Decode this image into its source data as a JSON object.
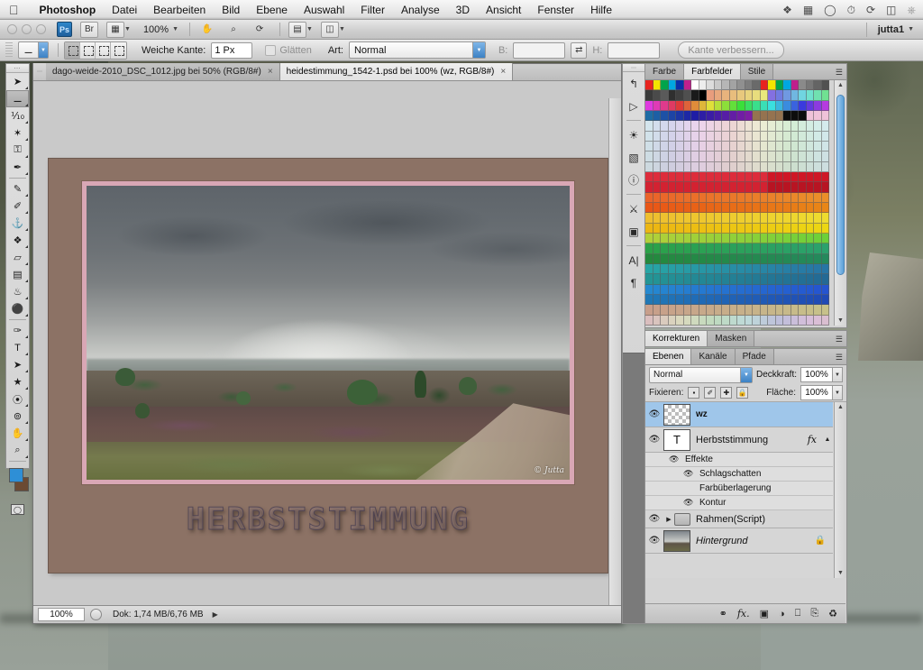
{
  "menubar": {
    "apple_icon": "apple-icon",
    "app_name": "Photoshop",
    "items": [
      "Datei",
      "Bearbeiten",
      "Bild",
      "Ebene",
      "Auswahl",
      "Filter",
      "Analyse",
      "3D",
      "Ansicht",
      "Fenster",
      "Hilfe"
    ],
    "status_icons": [
      "dropbox-icon",
      "display-icon",
      "chat-icon",
      "timemachine-icon",
      "sync-icon",
      "screen-icon",
      "bluetooth-icon"
    ]
  },
  "appbar": {
    "ps_badge": "Ps",
    "bridge_label": "Br",
    "viewextras_icon": "view-extras-icon",
    "zoom_level": "100%",
    "hand_icon": "hand-tool-icon",
    "zoom_icon": "zoom-tool-icon",
    "rotate_icon": "rotate-view-icon",
    "arrange_icon": "arrange-documents-icon",
    "screenmode_icon": "screen-mode-icon",
    "workspace": "jutta1"
  },
  "options": {
    "tool_preset_icon": "rectangular-marquee-icon",
    "selection_modes": [
      "new-selection",
      "add-to-selection",
      "subtract-from-selection",
      "intersect-selection"
    ],
    "feather_label": "Weiche Kante:",
    "feather_value": "1 Px",
    "antialias_label": "Glätten",
    "style_label": "Art:",
    "style_value": "Normal",
    "width_label": "B:",
    "width_value": "",
    "swap_icon": "swap-dimensions-icon",
    "height_label": "H:",
    "height_value": "",
    "refine_edge_label": "Kante verbessern..."
  },
  "toolbox": {
    "tools_top": [
      {
        "name": "move-tool",
        "glyph": "➤"
      },
      {
        "name": "rectangular-marquee-tool",
        "glyph": "⬚",
        "selected": true
      },
      {
        "name": "lasso-tool",
        "glyph": "⊃"
      },
      {
        "name": "magic-wand-tool",
        "glyph": "✦"
      },
      {
        "name": "crop-tool",
        "glyph": "⌗"
      },
      {
        "name": "eyedropper-tool",
        "glyph": "✒"
      }
    ],
    "tools_mid": [
      {
        "name": "healing-brush-tool",
        "glyph": "✐"
      },
      {
        "name": "brush-tool",
        "glyph": "✎"
      },
      {
        "name": "clone-stamp-tool",
        "glyph": "⚑"
      },
      {
        "name": "history-brush-tool",
        "glyph": "❦"
      },
      {
        "name": "eraser-tool",
        "glyph": "▱"
      },
      {
        "name": "gradient-tool",
        "glyph": "▨"
      },
      {
        "name": "blur-tool",
        "glyph": "●"
      },
      {
        "name": "dodge-tool",
        "glyph": "⚲"
      }
    ],
    "tools_bottom": [
      {
        "name": "pen-tool",
        "glyph": "✑"
      },
      {
        "name": "type-tool",
        "glyph": "T"
      },
      {
        "name": "path-selection-tool",
        "glyph": "➤"
      },
      {
        "name": "shape-tool",
        "glyph": "▰"
      },
      {
        "name": "3d-rotate-tool",
        "glyph": "⦿"
      },
      {
        "name": "3d-orbit-tool",
        "glyph": "⊚"
      },
      {
        "name": "hand-tool",
        "glyph": "✋"
      },
      {
        "name": "zoom-tool",
        "glyph": "⌕"
      }
    ],
    "screen_mode_icon": "screen-mode-icon",
    "foreground_color": "#2e8fd6",
    "background_color": "#6b4a33",
    "quickmask_icon": "quick-mask-icon"
  },
  "document": {
    "tabs": [
      {
        "label": "dago-weide-2010_DSC_1012.jpg bei 50% (RGB/8#)",
        "active": false
      },
      {
        "label": "heidestimmung_1542-1.psd bei 100% (wz, RGB/8#)",
        "active": true
      }
    ],
    "close_glyph": "×",
    "artwork_title": "HERBSTSTIMMUNG",
    "signature": "© Jutta",
    "mat_color": "#8c7265",
    "frame_color": "#d9a7b5"
  },
  "statusbar": {
    "zoom": "100%",
    "doc_info": "Dok: 1,74 MB/6,76 MB",
    "arrow_glyph": "▶"
  },
  "dock": {
    "icon_strip": [
      "history-icon",
      "actions-icon",
      "adjustments-icon",
      "masks-icon",
      "info-icon",
      "clone-source-icon",
      "animation-icon",
      "character-icon",
      "paragraph-icon"
    ],
    "color_panel": {
      "tabs": [
        "Farbe",
        "Farbfelder",
        "Stile"
      ],
      "active_tab": "Farbfelder",
      "menu_icon": "panel-menu-icon"
    },
    "corrections_panel": {
      "tabs": [
        "Korrekturen",
        "Masken"
      ],
      "active_tab": "Korrekturen",
      "menu_icon": "panel-menu-icon"
    },
    "layers_panel": {
      "tabs": [
        "Ebenen",
        "Kanäle",
        "Pfade"
      ],
      "active_tab": "Ebenen",
      "menu_icon": "panel-menu-icon",
      "blend_mode": "Normal",
      "opacity_label": "Deckkraft:",
      "opacity_value": "100%",
      "lock_label": "Fixieren:",
      "lock_icons": [
        "lock-transparent-pixels",
        "lock-image-pixels",
        "lock-position",
        "lock-all"
      ],
      "fill_label": "Fläche:",
      "fill_value": "100%",
      "layers": [
        {
          "name": "wz",
          "type": "pixel",
          "selected": true,
          "visible": true,
          "thumb": "checker",
          "bold": true
        },
        {
          "name": "Herbststimmung",
          "type": "text",
          "selected": false,
          "visible": true,
          "thumb": "T",
          "fx": "fx",
          "effects_label": "Effekte",
          "effects": [
            "Schlagschatten",
            "Farbüberlagerung",
            "Kontur"
          ]
        },
        {
          "name": "Rahmen(Script)",
          "type": "group",
          "selected": false,
          "visible": true,
          "thumb": "folder"
        },
        {
          "name": "Hintergrund",
          "type": "background",
          "selected": false,
          "visible": true,
          "thumb": "photo",
          "italic": true,
          "locked": true
        }
      ],
      "footer_icons": [
        "link-layers-icon",
        "add-layer-style-icon",
        "add-layer-mask-icon",
        "new-adjustment-layer-icon",
        "new-group-icon",
        "new-layer-icon",
        "delete-layer-icon"
      ],
      "footer_glyphs": [
        "⚭",
        "fx",
        "▣",
        "◑",
        "▭",
        "❐",
        "♻"
      ]
    }
  },
  "swatches": {
    "rows": 24,
    "cols": 24,
    "palette_description": "Photoshop default color swatch grid with rainbow gradient bands"
  }
}
